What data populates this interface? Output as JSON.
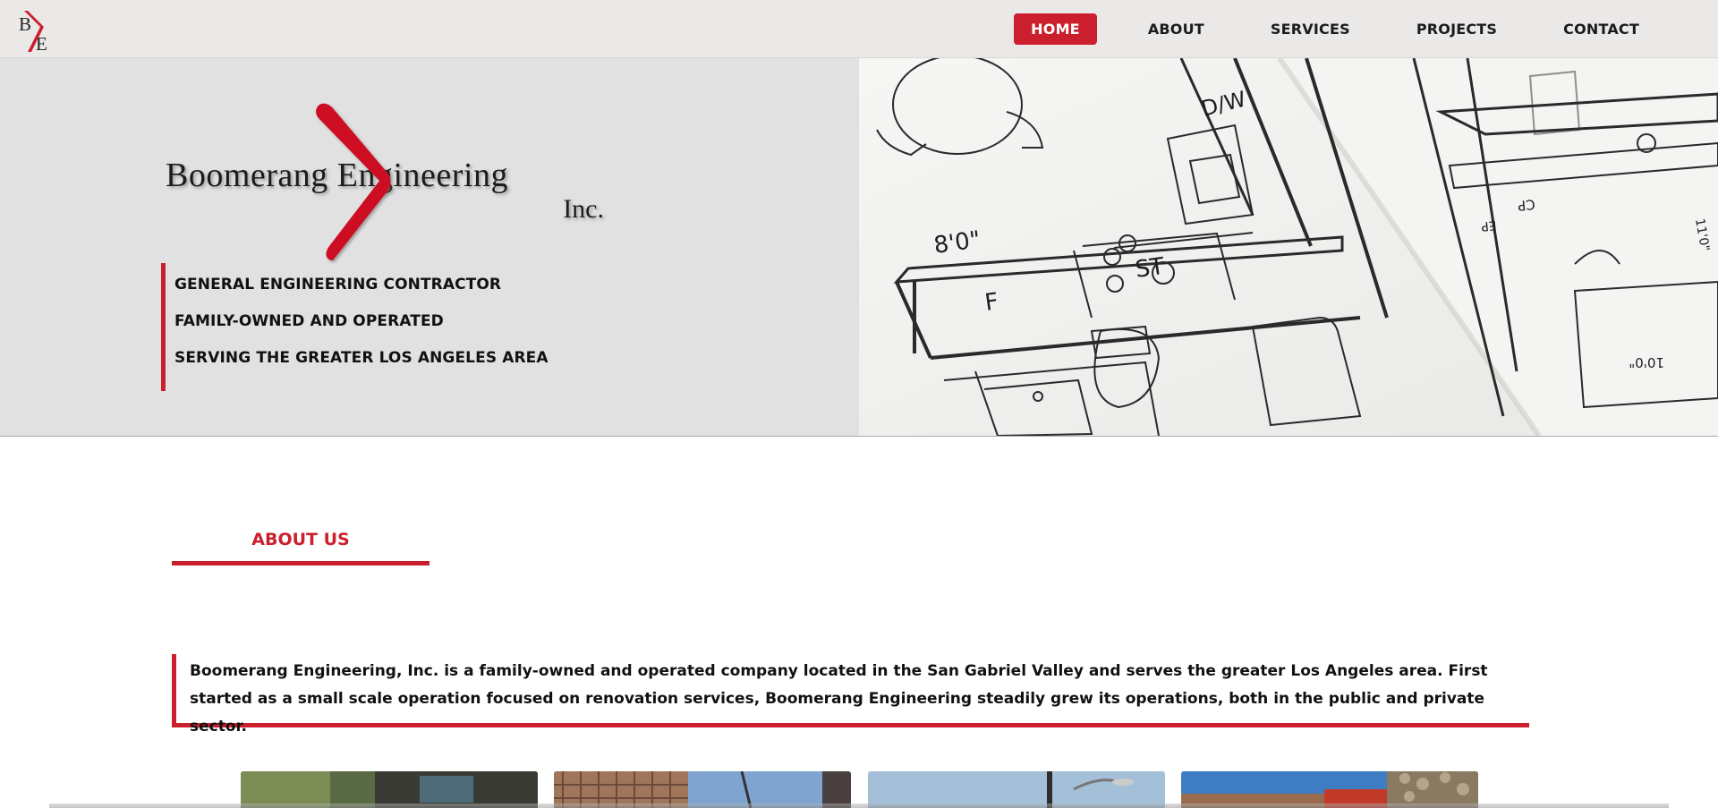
{
  "nav": {
    "logo_letters": [
      "B",
      "E"
    ],
    "items": [
      {
        "label": "HOME",
        "active": true
      },
      {
        "label": "ABOUT",
        "active": false
      },
      {
        "label": "SERVICES",
        "active": false
      },
      {
        "label": "PROJECTS",
        "active": false
      },
      {
        "label": "CONTACT",
        "active": false
      }
    ]
  },
  "hero": {
    "logo": {
      "name": "Boomerang Engineering",
      "suffix": "Inc."
    },
    "taglines": [
      "GENERAL ENGINEERING CONTRACTOR",
      "FAMILY-OWNED AND OPERATED",
      "SERVING THE GREATER LOS ANGELES AREA"
    ],
    "blueprint_labels": [
      "D/W",
      "8'0\"",
      "F",
      "ST",
      "CP",
      "EP",
      "10'0\"",
      "11'0\""
    ]
  },
  "about": {
    "heading": "ABOUT US",
    "text": "Boomerang Engineering, Inc. is a family-owned and operated company located in the San Gabriel Valley and serves the greater Los Angeles area. First started as a small scale operation focused on renovation services, Boomerang Engineering steadily grew its operations, both in the public and private sector."
  },
  "colors": {
    "accent": "#cc1f2d",
    "nav_bg": "#ebe8e8",
    "hero_bg": "#e1e1e2"
  }
}
